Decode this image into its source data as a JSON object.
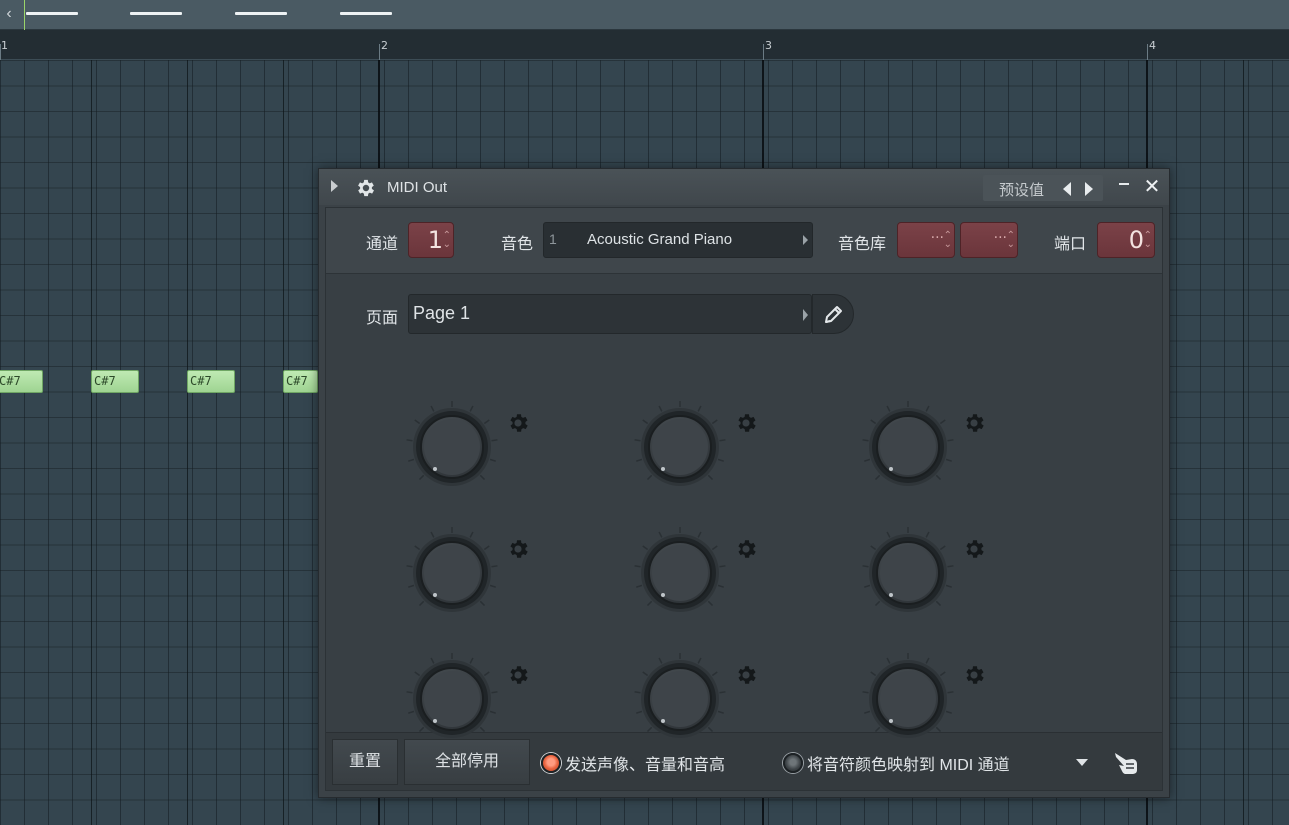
{
  "piano_roll": {
    "bar_numbers": [
      "1",
      "2",
      "3",
      "4"
    ],
    "note_labels": [
      "C#7",
      "C#7",
      "C#7",
      "C#7"
    ],
    "note_color": "#b3e3a6"
  },
  "window": {
    "title": "MIDI Out",
    "preset_label": "预设值"
  },
  "controls": {
    "channel_label": "通道",
    "channel_value": "1",
    "program_label": "音色",
    "program_number": "1",
    "program_name": "Acoustic Grand Piano",
    "bank_label": "音色库",
    "bank_msb_value": "···",
    "bank_lsb_value": "···",
    "port_label": "端口",
    "port_value": "0"
  },
  "page": {
    "label": "页面",
    "value": "Page 1"
  },
  "knobs": {
    "count": 9,
    "icon": "gear-icon"
  },
  "bottom": {
    "reset_label": "重置",
    "disable_all_label": "全部停用",
    "send_pan_vol_pitch_label": "发送声像、音量和音高",
    "send_pan_vol_pitch_on": true,
    "map_note_color_label": "将音符颜色映射到 MIDI 通道",
    "map_note_color_on": false
  },
  "colors": {
    "accent_red": "#7b4248",
    "radio_on": "#e9633f",
    "panel_bg": "#383f44"
  }
}
